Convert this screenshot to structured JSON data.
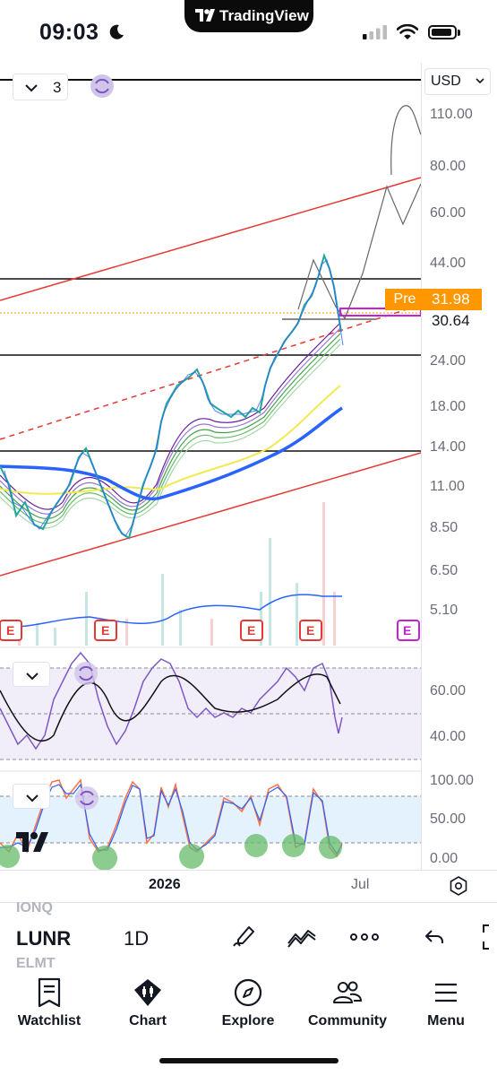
{
  "status_bar": {
    "time": "09:03",
    "brand": "TradingView"
  },
  "chart": {
    "currency": "USD",
    "interval_count": "3",
    "pre_label": "Pre",
    "pre_price": "31.98",
    "last_price": "30.64",
    "price_axis": [
      "110.00",
      "80.00",
      "60.00",
      "44.00",
      "24.00",
      "18.00",
      "14.00",
      "11.00",
      "8.50",
      "6.50",
      "5.10"
    ],
    "rsi_axis": [
      "60.00",
      "40.00"
    ],
    "stoch_axis": [
      "100.00",
      "50.00",
      "0.00"
    ],
    "time_axis": {
      "year": "2026",
      "month": "Jul"
    },
    "earnings_marker": "E",
    "colors": {
      "accent": "#ff9800",
      "up": "#26a69a",
      "down": "#2962ff",
      "trend": "#e53935",
      "ma_yellow": "#f2e94e",
      "ma_blue": "#2962ff",
      "rsi": "#7e57c2"
    }
  },
  "toolbar": {
    "symbol": "LUNR",
    "interval": "1D",
    "watchlist_prev": "IONQ",
    "watchlist_next": "ELMT",
    "icons": [
      "draw-icon",
      "indicators-icon",
      "more-icon",
      "undo-icon"
    ]
  },
  "tabbar": {
    "tabs": [
      {
        "label": "Watchlist",
        "icon": "watchlist-icon"
      },
      {
        "label": "Chart",
        "icon": "chart-icon"
      },
      {
        "label": "Explore",
        "icon": "compass-icon"
      },
      {
        "label": "Community",
        "icon": "community-icon"
      },
      {
        "label": "Menu",
        "icon": "menu-icon"
      }
    ]
  }
}
